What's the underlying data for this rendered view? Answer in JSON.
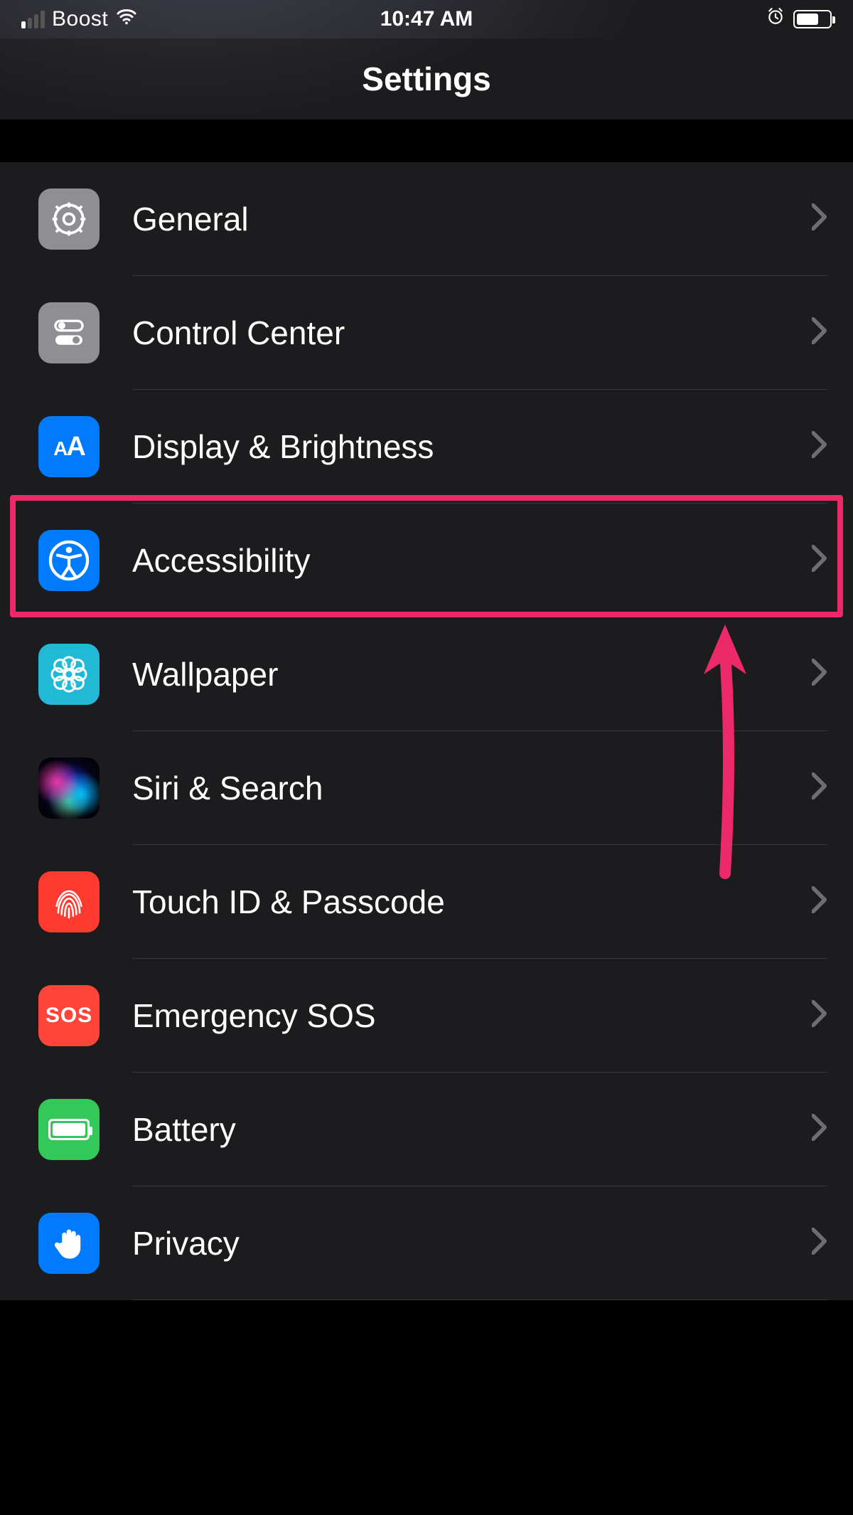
{
  "statusBar": {
    "carrier": "Boost",
    "time": "10:47 AM",
    "alarmSet": true,
    "signalBarsActive": 1,
    "batteryPercent": 60
  },
  "header": {
    "title": "Settings"
  },
  "rows": [
    {
      "id": "general",
      "label": "General",
      "icon": "gear-icon"
    },
    {
      "id": "controlcenter",
      "label": "Control Center",
      "icon": "toggles-icon"
    },
    {
      "id": "display",
      "label": "Display & Brightness",
      "icon": "aa-icon"
    },
    {
      "id": "accessibility",
      "label": "Accessibility",
      "icon": "accessibility-icon"
    },
    {
      "id": "wallpaper",
      "label": "Wallpaper",
      "icon": "flower-icon"
    },
    {
      "id": "siri",
      "label": "Siri & Search",
      "icon": "siri-icon"
    },
    {
      "id": "touchid",
      "label": "Touch ID & Passcode",
      "icon": "fingerprint-icon"
    },
    {
      "id": "sos",
      "label": "Emergency SOS",
      "icon": "sos-icon"
    },
    {
      "id": "battery",
      "label": "Battery",
      "icon": "battery-icon"
    },
    {
      "id": "privacy",
      "label": "Privacy",
      "icon": "hand-icon"
    }
  ],
  "annotation": {
    "highlightedRow": "accessibility",
    "highlightColor": "#ec2a6a"
  }
}
